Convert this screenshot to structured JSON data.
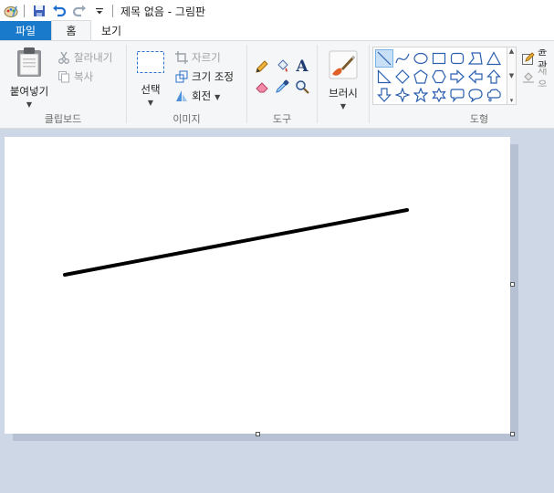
{
  "window": {
    "title": "제목 없음 - 그림판"
  },
  "quick_access": {
    "icons": [
      "paint-app-icon",
      "save-icon",
      "undo-icon",
      "redo-icon",
      "customize-dropdown-icon"
    ]
  },
  "tabs": {
    "file": "파일",
    "home": "홈",
    "view": "보기"
  },
  "clipboard": {
    "paste_label": "붙여넣기",
    "cut_label": "잘라내기",
    "copy_label": "복사",
    "group_label": "클립보드"
  },
  "image": {
    "select_label": "선택",
    "crop_label": "자르기",
    "resize_label": "크기 조정",
    "rotate_label": "회전",
    "group_label": "이미지"
  },
  "tools": {
    "group_label": "도구",
    "text_tool_glyph": "A"
  },
  "brushes": {
    "label": "브러시"
  },
  "shapes": {
    "group_label": "도형",
    "outline_label": "윤곽",
    "fill_label": "채우",
    "items": [
      "line",
      "curve",
      "oval",
      "rectangle",
      "rounded-rectangle",
      "polygon",
      "triangle",
      "right-triangle",
      "diamond",
      "pentagon",
      "hexagon",
      "right-arrow",
      "left-arrow",
      "up-arrow",
      "down-arrow",
      "four-point-star",
      "five-point-star",
      "six-point-star",
      "rounded-callout",
      "oval-callout",
      "cloud-callout"
    ],
    "selected": "line"
  },
  "canvas": {
    "background": "#ffffff",
    "stroke_color": "#000000"
  },
  "colors": {
    "accent": "#1979ca",
    "workspace": "#cdd7e6"
  }
}
